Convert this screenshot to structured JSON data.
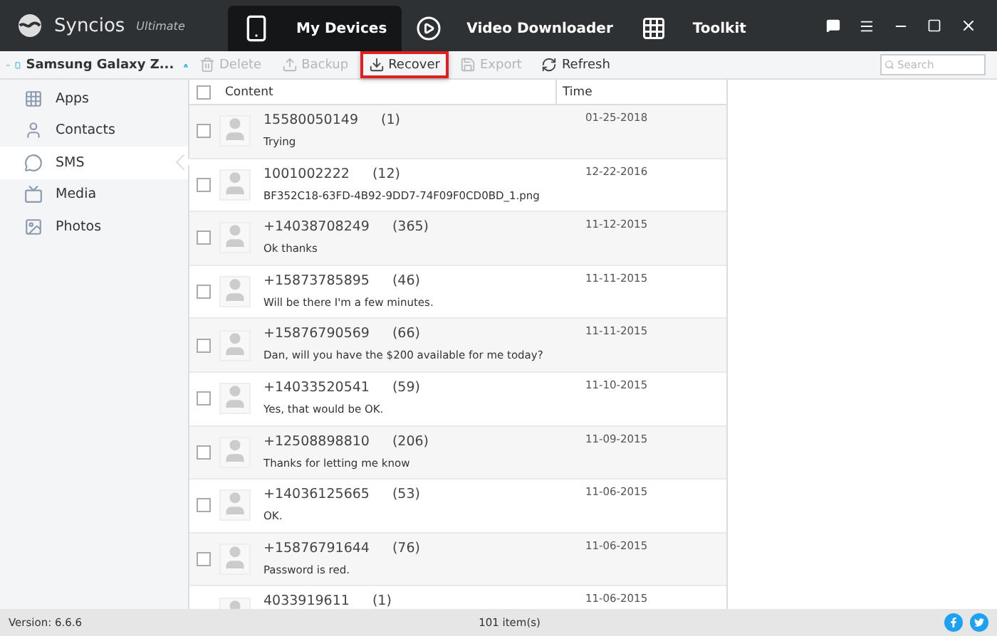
{
  "app": {
    "name": "Syncios",
    "edition": "Ultimate"
  },
  "nav_tabs": [
    {
      "label": "My Devices",
      "kind": "devices",
      "selected": true
    },
    {
      "label": "Video Downloader",
      "kind": "video",
      "selected": false
    },
    {
      "label": "Toolkit",
      "kind": "toolkit",
      "selected": false
    }
  ],
  "device": {
    "name": "Samsung Galaxy Z..."
  },
  "toolbar": [
    {
      "label": "Delete",
      "kind": "delete",
      "disabled": true,
      "highlighted": false
    },
    {
      "label": "Backup",
      "kind": "backup",
      "disabled": true,
      "highlighted": false
    },
    {
      "label": "Recover",
      "kind": "recover",
      "disabled": false,
      "highlighted": true
    },
    {
      "label": "Export",
      "kind": "export",
      "disabled": true,
      "highlighted": false
    },
    {
      "label": "Refresh",
      "kind": "refresh",
      "disabled": false,
      "highlighted": false
    }
  ],
  "search": {
    "placeholder": "Search"
  },
  "sidebar": {
    "items": [
      {
        "label": "Apps",
        "kind": "apps",
        "selected": false
      },
      {
        "label": "Contacts",
        "kind": "contacts",
        "selected": false
      },
      {
        "label": "SMS",
        "kind": "sms",
        "selected": true
      },
      {
        "label": "Media",
        "kind": "media",
        "selected": false
      },
      {
        "label": "Photos",
        "kind": "photos",
        "selected": false
      }
    ]
  },
  "table": {
    "columns": [
      "Content",
      "Time"
    ],
    "select_all_checked": false,
    "rows": [
      {
        "number": "15580050149",
        "count": "(1)",
        "message": "Trying",
        "time": "01-25-2018",
        "checked": false
      },
      {
        "number": "1001002222",
        "count": "(12)",
        "message": "BF352C18-63FD-4B92-9DD7-74F09F0CD0BD_1.png",
        "time": "12-22-2016",
        "checked": false
      },
      {
        "number": "+14038708249",
        "count": "(365)",
        "message": "Ok thanks",
        "time": "11-12-2015",
        "checked": false
      },
      {
        "number": "+15873785895",
        "count": "(46)",
        "message": "Will be there I'm a few minutes.",
        "time": "11-11-2015",
        "checked": false
      },
      {
        "number": "+15876790569",
        "count": "(66)",
        "message": "Dan, will you have the $200 available for me today?",
        "time": "11-11-2015",
        "checked": false
      },
      {
        "number": "+14033520541",
        "count": "(59)",
        "message": "Yes, that would be OK.",
        "time": "11-10-2015",
        "checked": false
      },
      {
        "number": "+12508898810",
        "count": "(206)",
        "message": "Thanks for letting me know",
        "time": "11-09-2015",
        "checked": false
      },
      {
        "number": "+14036125665",
        "count": "(53)",
        "message": "OK.",
        "time": "11-06-2015",
        "checked": false
      },
      {
        "number": "+15876791644",
        "count": "(76)",
        "message": "Password is red.",
        "time": "11-06-2015",
        "checked": false
      },
      {
        "number": "4033919611",
        "count": "(1)",
        "time": "11-06-2015"
      }
    ]
  },
  "status_bar": {
    "version": "Version: 6.6.6",
    "count": "101 item(s)"
  }
}
